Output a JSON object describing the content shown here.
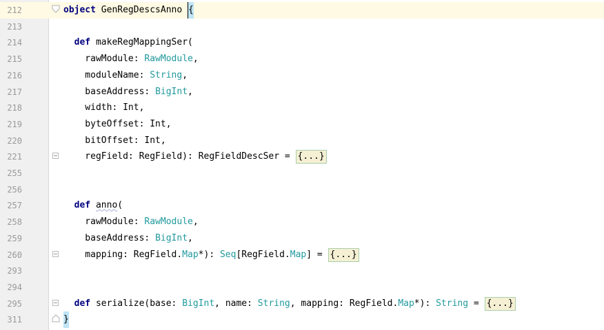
{
  "lines": [
    {
      "num": "212",
      "segments": [
        [
          "kw",
          "object"
        ],
        [
          "plain",
          " GenRegDescsAnno "
        ],
        [
          "brace",
          "{"
        ]
      ]
    },
    {
      "num": "213",
      "segments": []
    },
    {
      "num": "214",
      "segments": [
        [
          "plain",
          "  "
        ],
        [
          "kw",
          "def"
        ],
        [
          "plain",
          " makeRegMappingSer("
        ]
      ]
    },
    {
      "num": "215",
      "segments": [
        [
          "plain",
          "    rawModule: "
        ],
        [
          "type",
          "RawModule"
        ],
        [
          "plain",
          ","
        ]
      ]
    },
    {
      "num": "216",
      "segments": [
        [
          "plain",
          "    moduleName: "
        ],
        [
          "type",
          "String"
        ],
        [
          "plain",
          ","
        ]
      ]
    },
    {
      "num": "217",
      "segments": [
        [
          "plain",
          "    baseAddress: "
        ],
        [
          "type",
          "BigInt"
        ],
        [
          "plain",
          ","
        ]
      ]
    },
    {
      "num": "218",
      "segments": [
        [
          "plain",
          "    width: Int,"
        ]
      ]
    },
    {
      "num": "219",
      "segments": [
        [
          "plain",
          "    byteOffset: Int,"
        ]
      ]
    },
    {
      "num": "220",
      "segments": [
        [
          "plain",
          "    bitOffset: Int,"
        ]
      ]
    },
    {
      "num": "221",
      "segments": [
        [
          "plain",
          "    regField: RegField): RegFieldDescSer = "
        ],
        [
          "fold",
          "{...}"
        ]
      ]
    },
    {
      "num": "255",
      "segments": []
    },
    {
      "num": "256",
      "segments": []
    },
    {
      "num": "257",
      "segments": [
        [
          "plain",
          "  "
        ],
        [
          "kw",
          "def"
        ],
        [
          "plain",
          " "
        ],
        [
          "squig",
          "anno"
        ],
        [
          "plain",
          "("
        ]
      ]
    },
    {
      "num": "258",
      "segments": [
        [
          "plain",
          "    rawModule: "
        ],
        [
          "type",
          "RawModule"
        ],
        [
          "plain",
          ","
        ]
      ]
    },
    {
      "num": "259",
      "segments": [
        [
          "plain",
          "    baseAddress: "
        ],
        [
          "type",
          "BigInt"
        ],
        [
          "plain",
          ","
        ]
      ]
    },
    {
      "num": "260",
      "segments": [
        [
          "plain",
          "    mapping: RegField."
        ],
        [
          "type",
          "Map"
        ],
        [
          "plain",
          "*): "
        ],
        [
          "type",
          "Seq"
        ],
        [
          "plain",
          "[RegField."
        ],
        [
          "type",
          "Map"
        ],
        [
          "plain",
          "] = "
        ],
        [
          "fold",
          "{...}"
        ]
      ]
    },
    {
      "num": "293",
      "segments": []
    },
    {
      "num": "294",
      "segments": []
    },
    {
      "num": "295",
      "segments": [
        [
          "plain",
          "  "
        ],
        [
          "kw",
          "def"
        ],
        [
          "plain",
          " serialize(base: "
        ],
        [
          "type",
          "BigInt"
        ],
        [
          "plain",
          ", name: "
        ],
        [
          "type",
          "String"
        ],
        [
          "plain",
          ", mapping: RegField."
        ],
        [
          "type",
          "Map"
        ],
        [
          "plain",
          "*): "
        ],
        [
          "type",
          "String"
        ],
        [
          "plain",
          " = "
        ],
        [
          "fold",
          "{...}"
        ]
      ]
    },
    {
      "num": "311",
      "segments": [
        [
          "brace",
          "}"
        ]
      ]
    }
  ]
}
